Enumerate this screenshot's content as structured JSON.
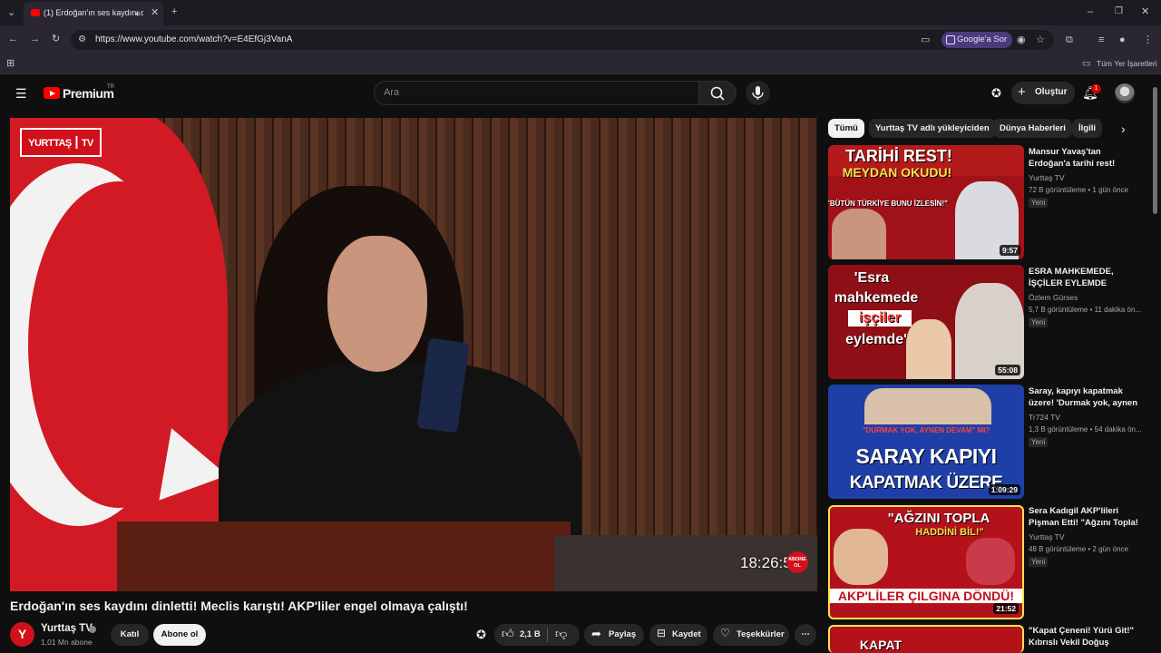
{
  "browser": {
    "tab_title": "(1) Erdoğan'ın ses kaydını d",
    "url": "https://www.youtube.com/watch?v=E4EfGj3VanA",
    "google_ask": "Google'a Sor",
    "bookmarks_label": "Tüm Yer İşaretleri"
  },
  "header": {
    "logo": "Premium",
    "logo_region": "TR",
    "search_placeholder": "Ara",
    "create_label": "Oluştur",
    "notification_count": "1"
  },
  "player": {
    "watermark": "YURTTAŞ",
    "watermark_suffix": "TV",
    "clock": "18:26:5",
    "badge": "ABONE OL"
  },
  "video": {
    "title": "Erdoğan'ın ses kaydını dinletti! Meclis karıştı! AKP'liler engel olmaya çalıştı!",
    "channel_initial": "Y",
    "channel": "Yurttaş TV",
    "subscribers": "1,01 Mn abone",
    "join_label": "Katıl",
    "subscribe_label": "Abone ol",
    "likes": "2,1 B",
    "share_label": "Paylaş",
    "save_label": "Kaydet",
    "thanks_label": "Teşekkürler"
  },
  "chips": [
    "Tümü",
    "Yurttaş TV adlı yükleyiciden",
    "Dünya Haberleri",
    "İlgili"
  ],
  "recommendations": [
    {
      "title": "Mansur Yavaş'tan Erdoğan'a tarihi rest! \"Bütün Türkiye ...",
      "channel": "Yurttaş TV",
      "meta": "72 B görüntüleme • 1 gün önce",
      "badge": "Yeni",
      "duration": "9:57",
      "thumb_line1": "TARİHİ REST!",
      "thumb_line2": "MEYDAN OKUDU!",
      "thumb_line3": "\"BÜTÜN TÜRKİYE BUNU İZLESİN!\""
    },
    {
      "title": "ESRA MAHKEMEDE, İŞÇİLER EYLEMDE",
      "channel": "Özlem Gürses",
      "meta": "5,7 B görüntüleme • 11 dakika ön...",
      "badge": "Yeni",
      "duration": "55:08",
      "thumb_line1": "'Esra",
      "thumb_line2": "mahkemede",
      "thumb_line3": "işçiler",
      "thumb_line4": "eylemde'"
    },
    {
      "title": "Saray, kapıyı kapatmak üzere! 'Durmak yok, aynen yola ...",
      "channel": "Tr724 TV",
      "meta": "1,3 B görüntüleme • 54 dakika ön...",
      "badge": "Yeni",
      "duration": "1:09:29",
      "thumb_line1": "\"DURMAK YOK, AYNEN DEVAM\" MI?",
      "thumb_line2": "SARAY KAPIYI",
      "thumb_line3": "KAPATMAK ÜZERE"
    },
    {
      "title": "Sera Kadıgil AKP'lileri Pişman Etti! \"Ağzını Topla! Haddini ...",
      "channel": "Yurttaş TV",
      "meta": "48 B görüntüleme • 2 gün önce",
      "badge": "Yeni",
      "duration": "21:52",
      "thumb_line1": "\"AĞZINI TOPLA",
      "thumb_line2": "HADDİNİ BİL!\"",
      "thumb_line3": "AKP'LİLER ÇILGINA DÖNDÜ!"
    },
    {
      "title": "\"Kapat Çeneni! Yürü Git!\" Kıbrıslı Vekil Doğuş Derya'd...",
      "thumb_line1": "KAPAT"
    }
  ],
  "colors": {
    "yt_red": "#ff0000",
    "channel_red": "#d0101b",
    "bg": "#0f0f0f",
    "chip_bg": "#272727"
  }
}
